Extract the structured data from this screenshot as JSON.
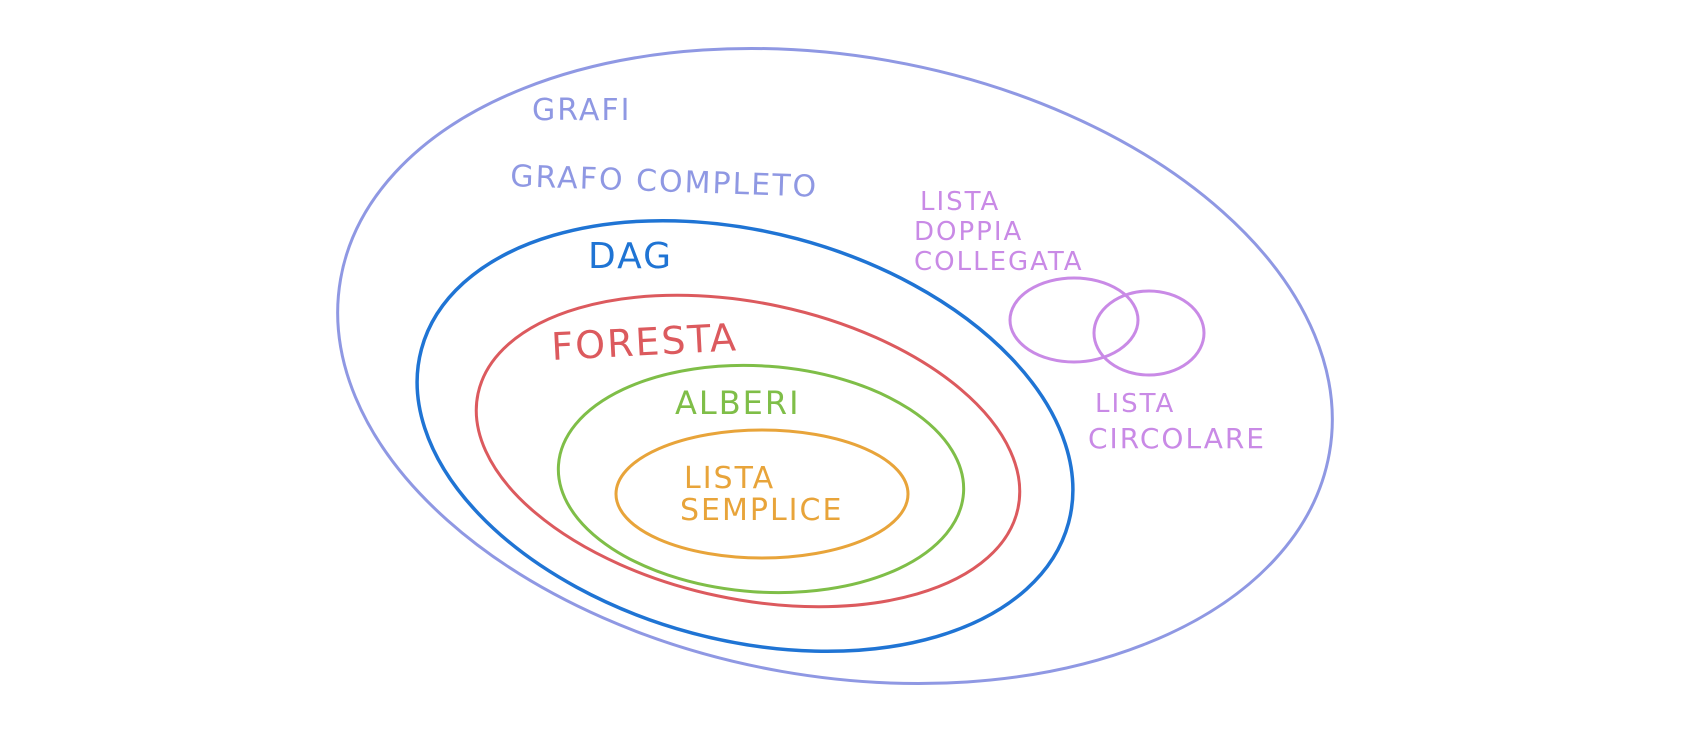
{
  "diagram": {
    "labels": {
      "grafi": "GRAFI",
      "grafo_completo": "GRAFO COMPLETO",
      "dag": "DAG",
      "foresta": "FORESTA",
      "alberi": "ALBERI",
      "lista_semplice_line1": "LISTA",
      "lista_semplice_line2": "SEMPLICE",
      "lista_doppia_line1": "LISTA",
      "lista_doppia_line2": "DOPPIA",
      "lista_doppia_line3": "COLLEGATA",
      "lista_circolare_line1": "LISTA",
      "lista_circolare_line2": "CIRCOLARE"
    },
    "colors": {
      "grafi": "#8f98e3",
      "dag": "#1f74d4",
      "foresta": "#dc5a5e",
      "alberi": "#7fbe48",
      "lista_semplice": "#e8a43a",
      "lista_doppia": "#c98ae6",
      "lista_circolare": "#c98ae6"
    }
  }
}
